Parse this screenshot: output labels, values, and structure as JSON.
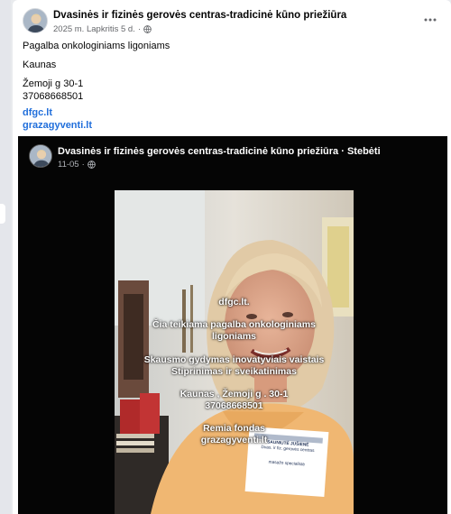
{
  "post": {
    "page_name": "Dvasinės ir fizinės gerovės centras-tradicinė kūno priežiūra",
    "timestamp": "2025 m. Lapkritis 5 d.",
    "dot": "·",
    "lines": [
      "Pagalba onkologiniams ligoniams",
      "Kaunas",
      "Žemoji g 30-1",
      "37068668501"
    ],
    "links": [
      "dfgc.lt",
      "grazagyventi.lt"
    ]
  },
  "video": {
    "page_name": "Dvasinės ir fizinės gerovės centras-tradicinė kūno priežiūra",
    "separator": "·",
    "follow_label": "Stebėti",
    "timestamp": "11-05",
    "dot": "·",
    "overlay": {
      "site": "dfgc.lt.",
      "service_line1": "Čia  teikiama pagalba onkologiniams",
      "service_line2": "ligoniams",
      "therapy_line1": "Skausmo gydymas inovatyviais vaistais",
      "therapy_line2": "Stiprinimas ir sveikatinimas",
      "address": "Kaunas , Žemoji g . 30-1",
      "phone": "37068668501",
      "fund_line": "Remia fondas",
      "fund_site": "grazagyventi.lt"
    },
    "badge": {
      "name": "SAUNIUTĖ JUŠIENĖ",
      "subtitle": "Dvas. ir fiz. gerovės centras",
      "role": "masažo specialistė"
    }
  },
  "colors": {
    "link": "#216fdb",
    "secondary_text": "#65676b",
    "video_bg": "#050505"
  },
  "icons": [
    "globe-icon",
    "more-options-icon"
  ]
}
